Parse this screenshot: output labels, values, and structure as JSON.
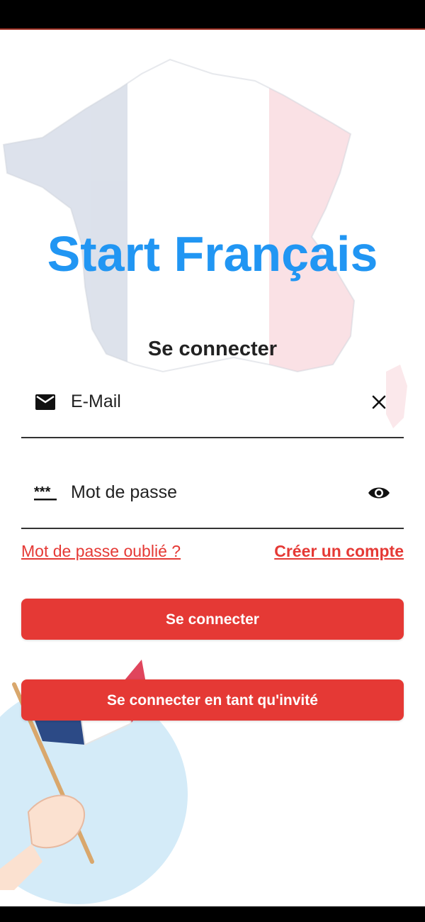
{
  "app": {
    "title": "Start Français",
    "subtitle": "Se connecter"
  },
  "form": {
    "email": {
      "label": "E-Mail",
      "lead_icon": "mail-icon",
      "trail_icon": "close-icon"
    },
    "password": {
      "label": "Mot de passe",
      "lead_icon": "password-dots-icon",
      "trail_icon": "eye-icon"
    }
  },
  "links": {
    "forgot": "Mot de passe oublié ?",
    "create_account": "Créer un compte"
  },
  "buttons": {
    "login": "Se connecter",
    "guest": "Se connecter en tant qu'invité"
  },
  "colors": {
    "brand_blue": "#2196f3",
    "accent_red": "#e53935",
    "flag_blue": "#2c4a86",
    "flag_red": "#e0455c"
  }
}
